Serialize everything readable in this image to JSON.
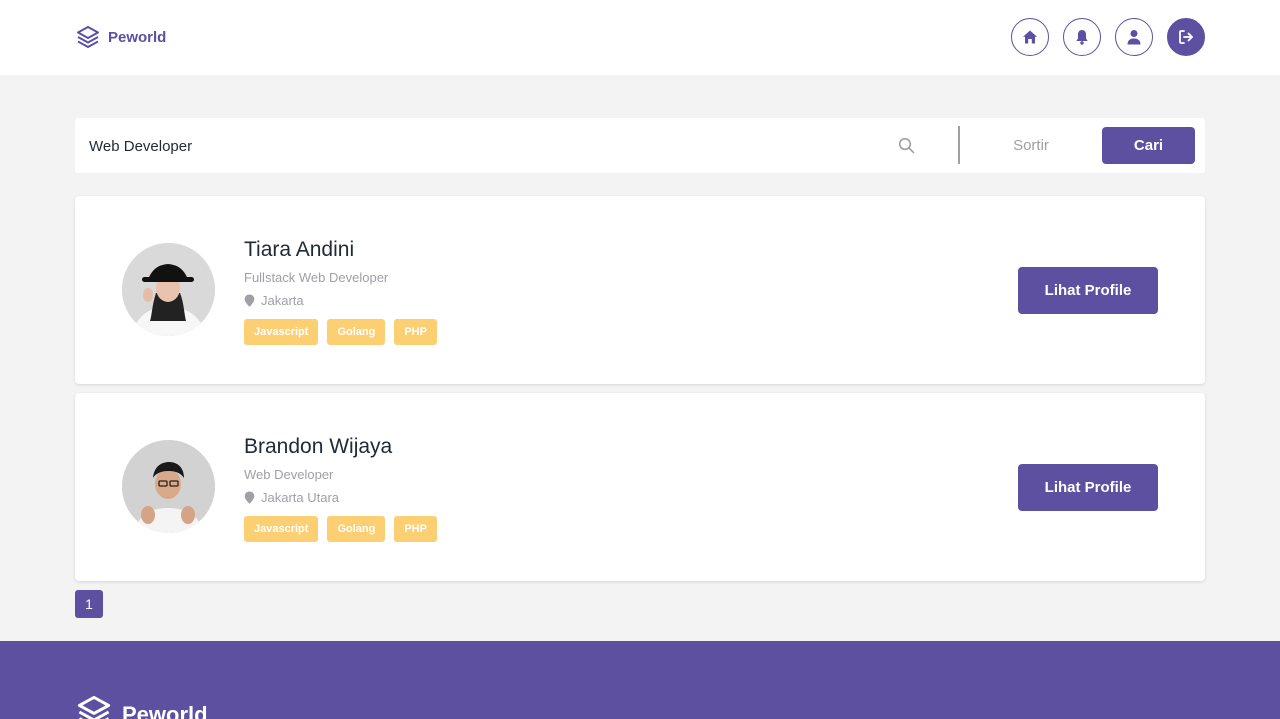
{
  "navbar": {
    "brand": "Peworld",
    "icons": [
      "home-icon",
      "bell-icon",
      "user-icon",
      "logout-icon"
    ]
  },
  "search": {
    "value": "Web Developer",
    "sort_label": "Sortir",
    "button_label": "Cari"
  },
  "profiles": [
    {
      "name": "Tiara Andini",
      "job": "Fullstack Web Developer",
      "location": "Jakarta",
      "skills": [
        "Javascript",
        "Golang",
        "PHP"
      ],
      "button_label": "Lihat Profile"
    },
    {
      "name": "Brandon Wijaya",
      "job": "Web Developer",
      "location": "Jakarta Utara",
      "skills": [
        "Javascript",
        "Golang",
        "PHP"
      ],
      "button_label": "Lihat Profile"
    }
  ],
  "pagination": {
    "pages": [
      "1"
    ],
    "current": "1"
  },
  "footer": {
    "brand": "Peworld"
  },
  "colors": {
    "primary": "#5e50a1",
    "skill": "#fbb017",
    "muted": "#9ea0a5",
    "background": "#f3f3f3"
  }
}
